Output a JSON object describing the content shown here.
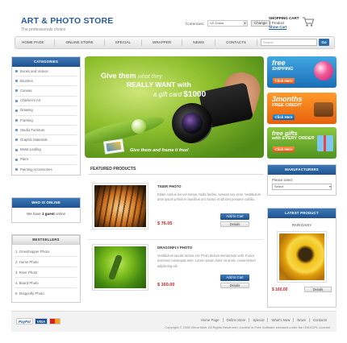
{
  "header": {
    "store_title": "ART & PHOTO STORE",
    "tagline": "The professionals choice",
    "currency_label": "Currencies:",
    "currency_value": "US Dollar",
    "change_label": "Change",
    "cart_title": "SHOPPING CART",
    "cart_count": "1 Product",
    "show_cart": "Show Cart"
  },
  "nav": {
    "items": [
      "HOME PAGE",
      "ONLINE STORE",
      "SPECIAL",
      "WRAPPER",
      "NEWS",
      "CONTACTS"
    ],
    "search_placeholder": "Search",
    "go_label": "Go"
  },
  "categories": {
    "title": "CATEGORIES",
    "items": [
      "Books and Videos",
      "Brushes",
      "Canvas",
      "Children's Art",
      "Drawing",
      "Framing",
      "Studio Furniture",
      "Graphic Materials",
      "Metal Leafing",
      "Paint",
      "Painting Accessories"
    ]
  },
  "who_online": {
    "title": "WHO IS ONLINE",
    "text_pre": "We have",
    "count_text": "1 guest",
    "text_post": "online"
  },
  "bestsellers": {
    "title": "BESTSELLERS",
    "items": [
      "1. Grasshopper Photo",
      "2. Horse Photo",
      "3. River Photo",
      "4. Board Photo",
      "5. Dragonfly Photo"
    ]
  },
  "banner": {
    "line1": "Give them",
    "line1_italic": "what they",
    "line2": "REALLY WANT with",
    "line3_italic": "a gift card",
    "line3_amount": "$1000",
    "footer": "Give them and frame it free!"
  },
  "promos": [
    {
      "big": "free",
      "small": "SHIPPING",
      "button": "Click Here"
    },
    {
      "big": "3months",
      "small": "FREE CREDIT",
      "button": "Click Here"
    },
    {
      "big": "free gifts",
      "small": "with EVERY ORDER",
      "button": "Click Here"
    }
  ],
  "featured": {
    "title": "FEATURED PRODUCTS",
    "products": [
      {
        "name": "TIGER PHOTO",
        "description": "Etiam cursus leo vel metus. Nulla facilisi. Aenean nec eros. Vestibulum ante ipsum primis in faucibus orci luctus et ultrices posuere cubilia.",
        "price": "$ 76.05",
        "add_label": "Add to Cart",
        "details_label": "Details"
      },
      {
        "name": "DRAGONFLY PHOTO",
        "description": "Vestibulum iaculis lacinia est. Proin dictum elementum velit. Fusce euismod consequat ante. Lorem ipsum dolor sit amet, consectetuer adipiscing elit.",
        "price": "$ 160.00",
        "add_label": "Add to Cart",
        "details_label": "Details"
      }
    ]
  },
  "manufacturers": {
    "title": "MANUFACTURERS",
    "label": "Please select",
    "select_value": "Select"
  },
  "latest": {
    "title": "LATEST PRODUCT",
    "name": "RAIN DAISY",
    "price": "$ 160.00",
    "details_label": "Details"
  },
  "footer": {
    "payments": [
      "PayPal",
      "VISA",
      ""
    ],
    "links": [
      "Home Page",
      "Online Store",
      "Special",
      "What's New",
      "News",
      "Contacts"
    ],
    "copyright": "Copyright © 2008 Virtue Mart. All Rights Reserved | Joomla! is Free Software released under the GNU/GPL License"
  },
  "colors": {
    "accent_blue": "#2a5a98",
    "price_red": "#cc2222",
    "button_orange": "#e2531a",
    "banner_green": "#8fc02e"
  }
}
